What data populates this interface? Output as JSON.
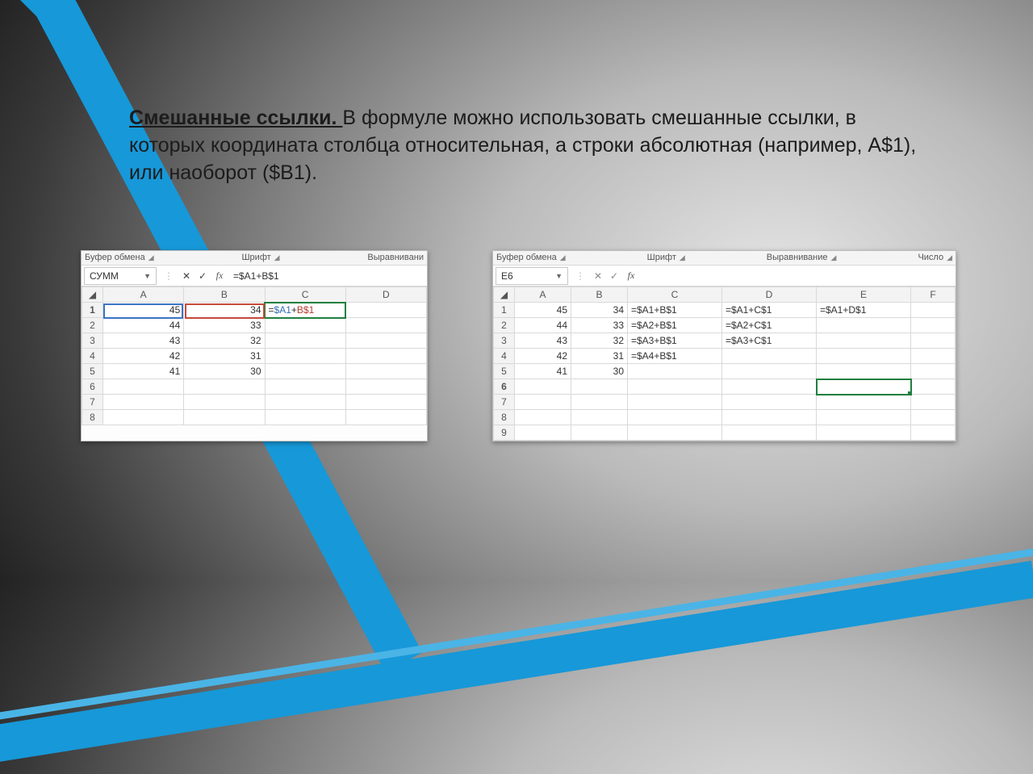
{
  "text": {
    "lead": "Смешанные ссылки. ",
    "body": "В формуле можно использовать смешанные ссылки, в которых координата столбца относительная, а строки абсолютная (например, А$1), или наоборот ($В1)."
  },
  "shot1": {
    "ribbon": {
      "g1": "Буфер обмена",
      "g2": "Шрифт",
      "g3": "Выравнивани"
    },
    "namebox": "СУММ",
    "formula": "=$A1+B$1",
    "cols": [
      "A",
      "B",
      "C",
      "D"
    ],
    "rows": [
      {
        "n": "1",
        "a": "45",
        "b": "34",
        "c_plain": "=",
        "c_a": "$A1",
        "c_plus": "+",
        "c_b": "B$1"
      },
      {
        "n": "2",
        "a": "44",
        "b": "33"
      },
      {
        "n": "3",
        "a": "43",
        "b": "32"
      },
      {
        "n": "4",
        "a": "42",
        "b": "31"
      },
      {
        "n": "5",
        "a": "41",
        "b": "30"
      },
      {
        "n": "6"
      },
      {
        "n": "7"
      },
      {
        "n": "8"
      }
    ]
  },
  "shot2": {
    "ribbon": {
      "g1": "Буфер обмена",
      "g2": "Шрифт",
      "g3": "Выравнивание",
      "g4": "Число"
    },
    "namebox": "E6",
    "formula": "",
    "cols": [
      "A",
      "B",
      "C",
      "D",
      "E",
      "F"
    ],
    "rows": [
      {
        "n": "1",
        "a": "45",
        "b": "34",
        "c": "=$A1+B$1",
        "d": "=$A1+C$1",
        "e": "=$A1+D$1"
      },
      {
        "n": "2",
        "a": "44",
        "b": "33",
        "c": "=$A2+B$1",
        "d": "=$A2+C$1"
      },
      {
        "n": "3",
        "a": "43",
        "b": "32",
        "c": "=$A3+B$1",
        "d": "=$A3+C$1"
      },
      {
        "n": "4",
        "a": "42",
        "b": "31",
        "c": "=$A4+B$1"
      },
      {
        "n": "5",
        "a": "41",
        "b": "30"
      },
      {
        "n": "6"
      },
      {
        "n": "7"
      },
      {
        "n": "8"
      },
      {
        "n": "9"
      }
    ]
  }
}
